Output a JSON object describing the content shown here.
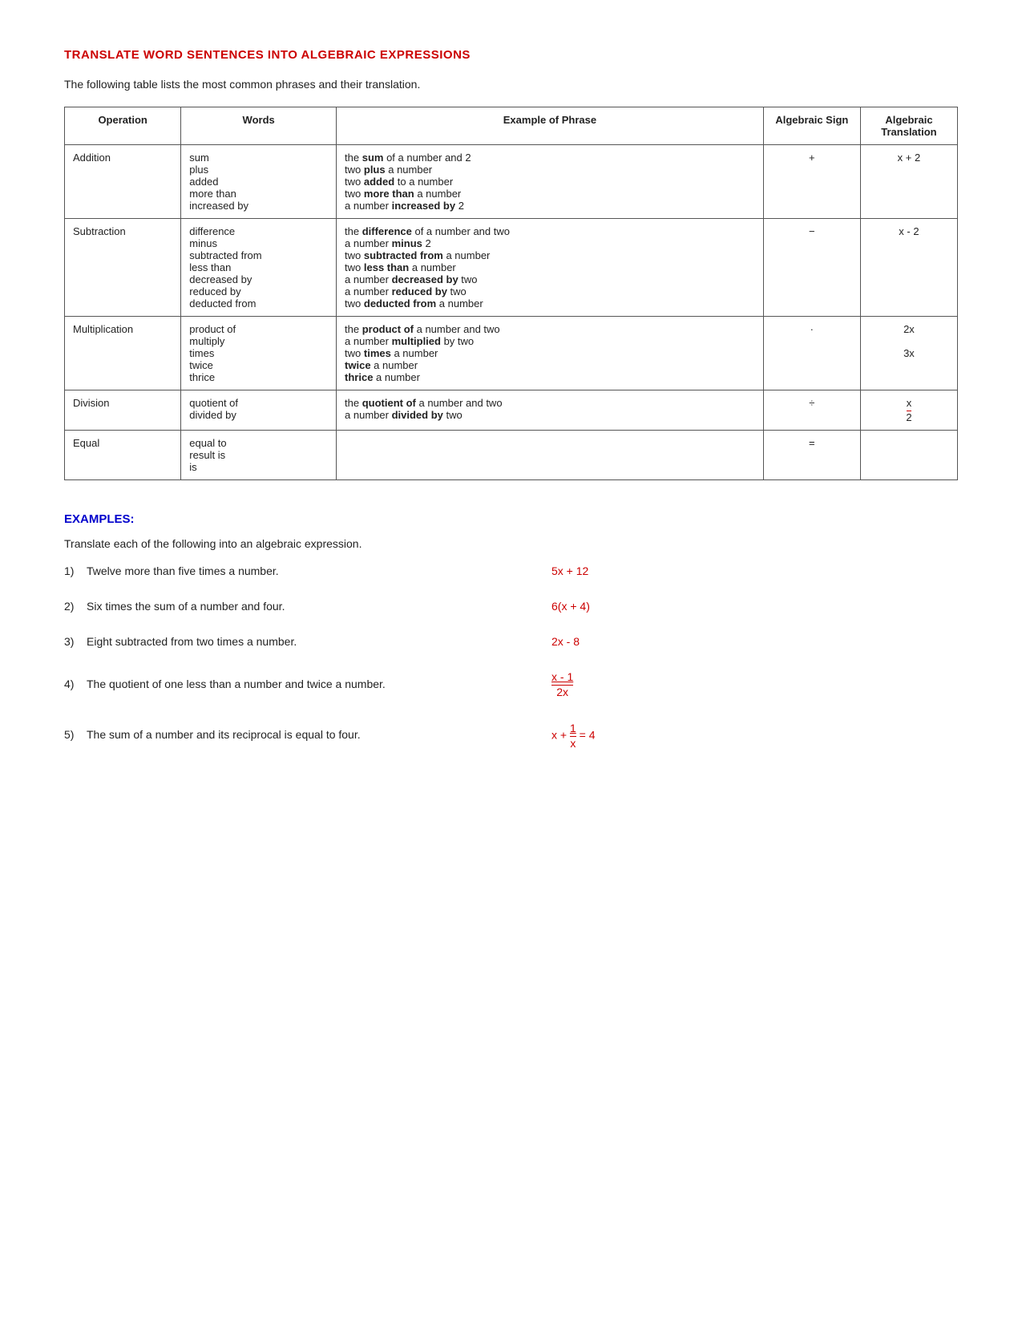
{
  "page": {
    "title": "TRANSLATE WORD SENTENCES INTO ALGEBRAIC EXPRESSIONS",
    "intro": "The following table lists the most common phrases and their translation.",
    "table": {
      "headers": [
        "Operation",
        "Words",
        "Example of Phrase",
        "Algebraic Sign",
        "Algebraic Translation"
      ],
      "rows": [
        {
          "operation": "Addition",
          "words": [
            "sum",
            "plus",
            "added",
            "more than",
            "increased by"
          ],
          "phrases": [
            "the <b>sum</b> of a number and 2",
            "two <b>plus</b> a number",
            "two <b>added</b> to a number",
            "two <b>more than</b> a number",
            "a number <b>increased by</b> 2"
          ],
          "sign": "+",
          "translation": "x + 2"
        },
        {
          "operation": "Subtraction",
          "words": [
            "difference",
            "minus",
            "subtracted from",
            "less than",
            "decreased by",
            "reduced by",
            "deducted from"
          ],
          "phrases": [
            "the <b>difference</b> of a number and two",
            "a number <b>minus</b> 2",
            "two <b>subtracted from</b> a number",
            "two <b>less than</b> a number",
            "a number <b>decreased by</b> two",
            "a number <b>reduced by</b> two",
            "two <b>deducted from</b> a number"
          ],
          "sign": "−",
          "translation": "x - 2"
        },
        {
          "operation": "Multiplication",
          "words": [
            "product of",
            "multiply",
            "times",
            "twice",
            "thrice"
          ],
          "phrases": [
            "the <b>product of</b> a number and two",
            "a number <b>multiplied</b> by two",
            "two <b>times</b> a number",
            "<b>twice</b> a number",
            "<b>thrice</b> a number"
          ],
          "sign": "·",
          "translation": "2x\n3x"
        },
        {
          "operation": "Division",
          "words": [
            "quotient of",
            "divided by"
          ],
          "phrases": [
            "the <b>quotient of</b> a number and two",
            "a number <b>divided by</b> two"
          ],
          "sign": "÷",
          "translation": "x/2"
        },
        {
          "operation": "Equal",
          "words": [
            "equal to",
            "result is",
            "is"
          ],
          "phrases": [],
          "sign": "=",
          "translation": ""
        }
      ]
    },
    "examples_section": {
      "title": "EXAMPLES:",
      "instruction": "Translate each of the following into an algebraic expression.",
      "items": [
        {
          "num": "1)",
          "question": "Twelve more than five times a number.",
          "answer_type": "simple",
          "answer": "5x + 12"
        },
        {
          "num": "2)",
          "question": "Six times the sum of a number and four.",
          "answer_type": "simple",
          "answer": "6(x + 4)"
        },
        {
          "num": "3)",
          "question": "Eight subtracted from two times a number.",
          "answer_type": "simple",
          "answer": "2x - 8"
        },
        {
          "num": "4)",
          "question": "The quotient of one less than a number and twice a number.",
          "answer_type": "fraction",
          "numerator": "x - 1",
          "denominator": "2x"
        },
        {
          "num": "5)",
          "question": "The sum of a number and its reciprocal is equal to four.",
          "answer_type": "fraction_eq",
          "prefix": "x + ",
          "numerator": "1",
          "denominator": "x",
          "suffix": " = 4"
        }
      ]
    }
  }
}
